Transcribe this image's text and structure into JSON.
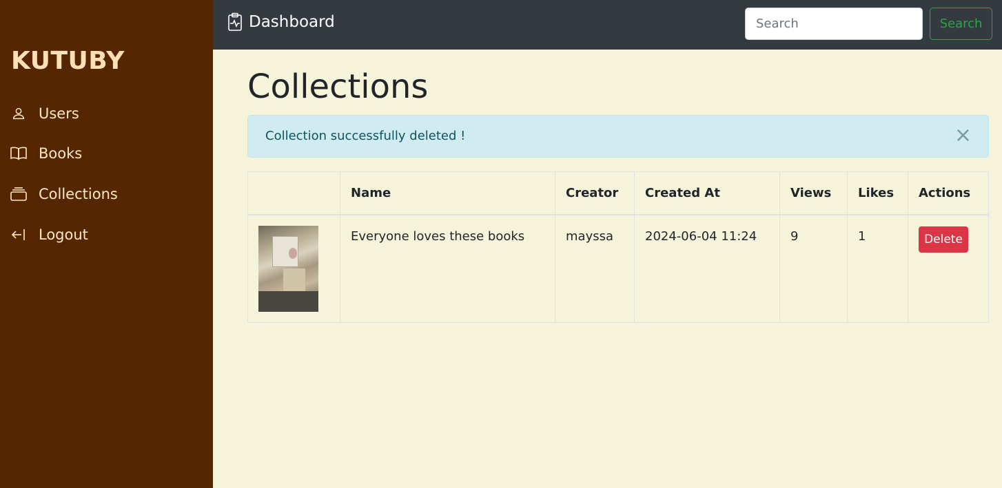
{
  "sidebar": {
    "brand": "KUTUBY",
    "items": [
      {
        "label": "Users",
        "icon": "user-icon"
      },
      {
        "label": "Books",
        "icon": "book-icon"
      },
      {
        "label": "Collections",
        "icon": "collection-icon"
      },
      {
        "label": "Logout",
        "icon": "logout-icon"
      }
    ]
  },
  "topbar": {
    "title": "Dashboard",
    "title_icon": "clipboard-pulse-icon",
    "search_placeholder": "Search",
    "search_button": "Search"
  },
  "main": {
    "title": "Collections",
    "alert": {
      "message": "Collection successfully deleted !",
      "close": "×"
    },
    "table": {
      "headers": [
        "",
        "Name",
        "Creator",
        "Created At",
        "Views",
        "Likes",
        "Actions"
      ],
      "rows": [
        {
          "name": "Everyone loves these books",
          "creator": "mayssa",
          "created_at": "2024-06-04 11:24",
          "views": "9",
          "likes": "1",
          "action": "Delete"
        }
      ]
    }
  },
  "colors": {
    "sidebar_bg": "#552600",
    "topbar_bg": "#343a40",
    "page_bg": "#f5f4da",
    "alert_bg": "#d1ecf1",
    "danger": "#dc3545",
    "success": "#28a745"
  }
}
